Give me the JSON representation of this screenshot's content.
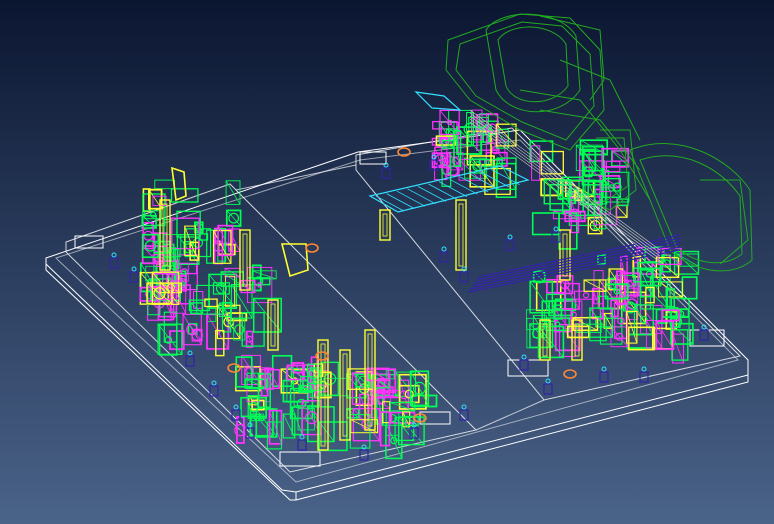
{
  "viewport": {
    "background_top": "#0b1631",
    "background_bottom": "#4a6389"
  },
  "colors": {
    "frame": "#ffffff",
    "fixture_primary": "#00ff55",
    "fixture_secondary": "#ff33ff",
    "clamp": "#ffff33",
    "robot": "#22aa22",
    "conveyor": "#33e0ff",
    "locator": "#3322aa",
    "marker": "#ff8833",
    "accent_blue": "#2233ff"
  },
  "model": {
    "name": "fixture-layout-wireframe",
    "parts": [
      {
        "name": "base-plate",
        "kind": "frame-icon"
      },
      {
        "name": "left-station",
        "kind": "fixture-icon"
      },
      {
        "name": "right-station",
        "kind": "fixture-icon"
      },
      {
        "name": "robot-arm",
        "kind": "robot-icon"
      },
      {
        "name": "conveyor-rail",
        "kind": "conveyor-icon"
      }
    ]
  }
}
